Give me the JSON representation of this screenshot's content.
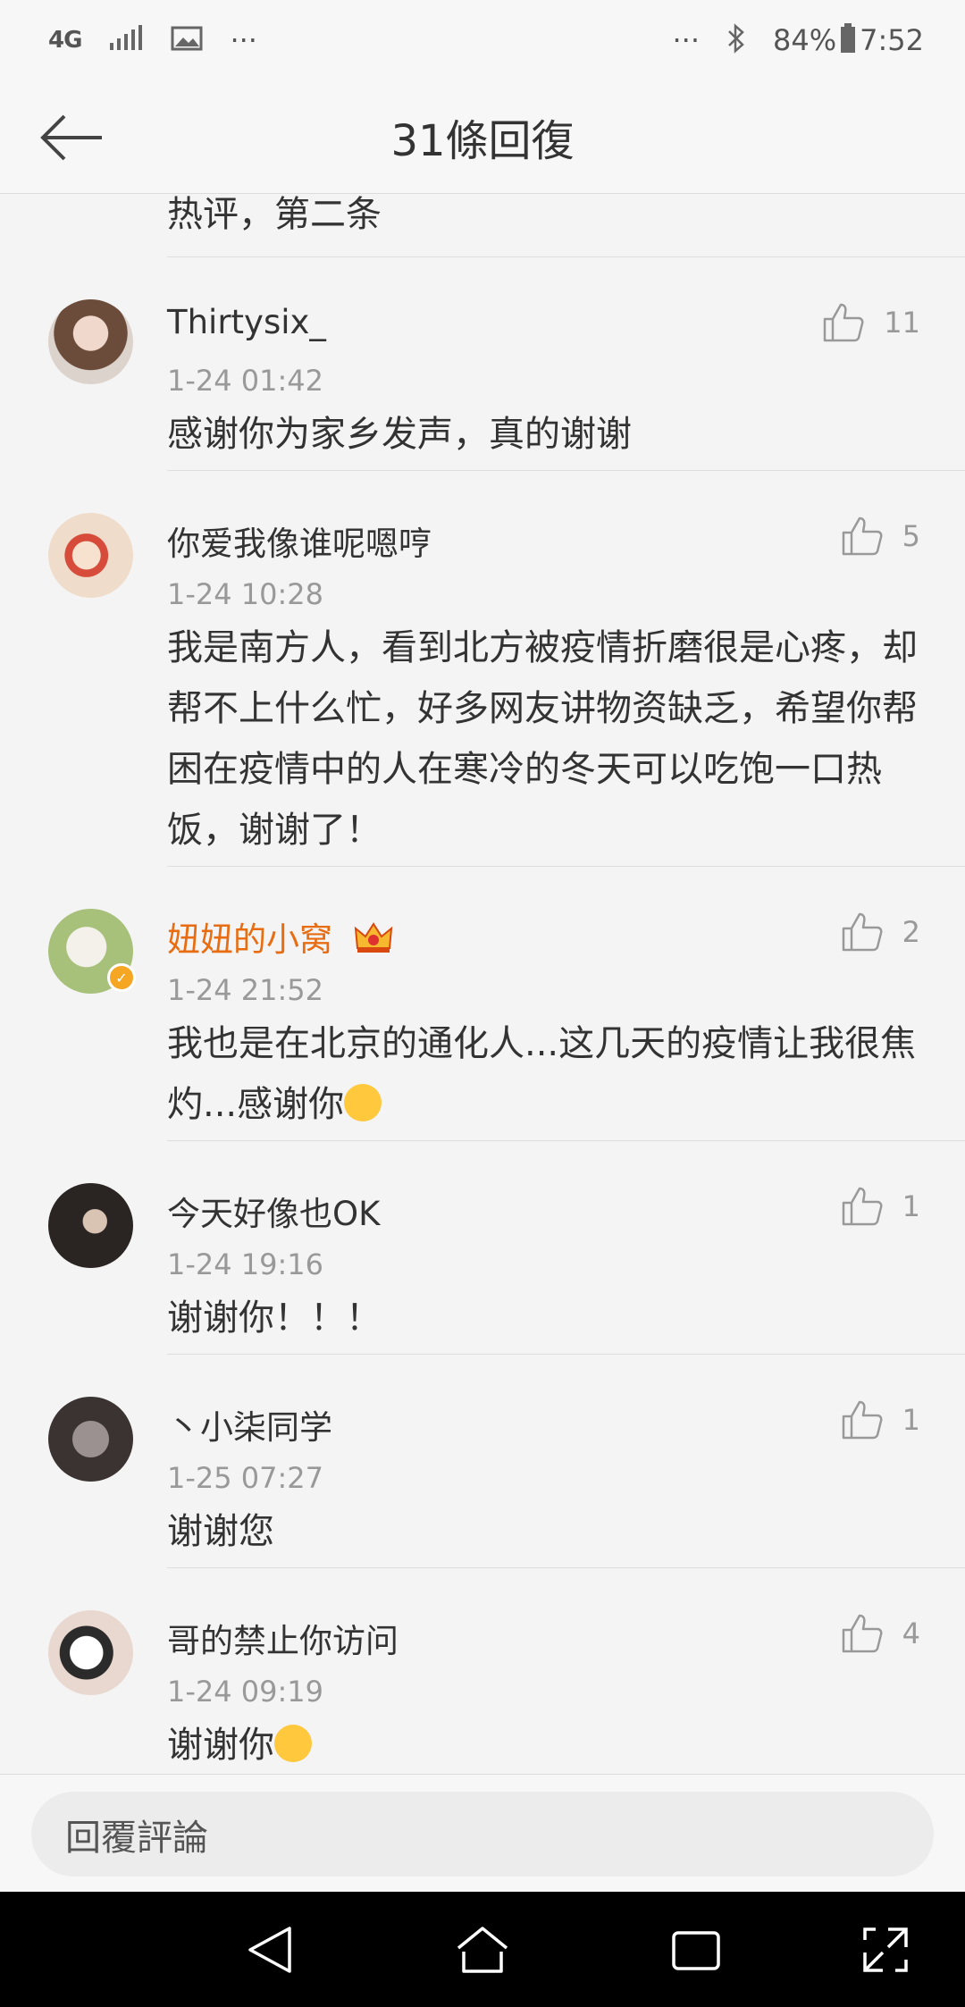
{
  "status_bar": {
    "network": "4G",
    "more": "···",
    "more_right": "···",
    "battery": "84%",
    "time": "7:52"
  },
  "header": {
    "title": "31條回復"
  },
  "partial_comment": {
    "text": "热评，第二条"
  },
  "comments": [
    {
      "username": "Thirtysix_",
      "time": "1-24 01:42",
      "likes": "11",
      "text": "感谢你为家乡发声，真的谢谢"
    },
    {
      "username": "你爱我像谁呢嗯哼",
      "time": "1-24 10:28",
      "likes": "5",
      "text": "我是南方人，看到北方被疫情折磨很是心疼，却帮不上什么忙，好多网友讲物资缺乏，希望你帮困在疫情中的人在寒冷的冬天可以吃饱一口热饭，谢谢了！"
    },
    {
      "username": "妞妞的小窝",
      "time": "1-24 21:52",
      "likes": "2",
      "text": "我也是在北京的通化人...这几天的疫情让我很焦灼...感谢你"
    },
    {
      "username": "今天好像也OK",
      "time": "1-24 19:16",
      "likes": "1",
      "text": "谢谢你！！！"
    },
    {
      "username": "丶小柒同学",
      "time": "1-25 07:27",
      "likes": "1",
      "text": "谢谢您"
    },
    {
      "username": "哥的禁止你访问",
      "time": "1-24 09:19",
      "likes": "4",
      "text": "谢谢你"
    }
  ],
  "reply": {
    "placeholder": "回覆評論"
  },
  "colors": {
    "vip_name": "#e86c11",
    "verified_badge": "#f5a623"
  }
}
